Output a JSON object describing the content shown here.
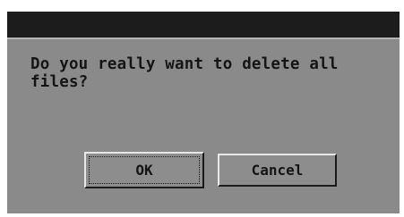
{
  "dialog": {
    "message": "Do you really want to delete all\nfiles?",
    "ok_label": "OK",
    "cancel_label": "Cancel"
  },
  "colors": {
    "titlebar": "#1c1c1c",
    "dialog_background": "#8a8a8a",
    "text": "#151515",
    "bevel_light": "#e8e8e8",
    "bevel_dark": "#1a1a1a"
  }
}
